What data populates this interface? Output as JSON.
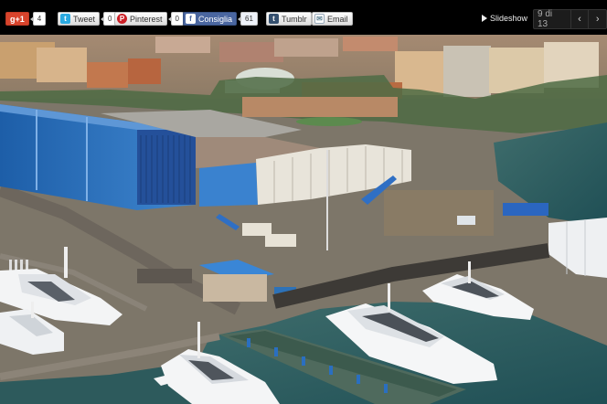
{
  "share": {
    "googleplus": {
      "label": "g+1",
      "count": "4"
    },
    "twitter": {
      "label": "Tweet",
      "count": "0"
    },
    "pinterest": {
      "label": "Pinterest",
      "count": "0"
    },
    "facebook": {
      "label": "Consiglia",
      "count": "61"
    },
    "tumblr": {
      "label": "Tumblr"
    },
    "email": {
      "label": "Email"
    }
  },
  "gallery": {
    "slideshow_label": "Slideshow",
    "counter": "9 di 13",
    "prev_icon": "chevron-left-icon",
    "next_icon": "chevron-right-icon"
  },
  "colors": {
    "bar_bg": "#000000",
    "facebook": "#4a66a0",
    "googleplus": "#d8442c",
    "twitter": "#2aa9e0",
    "pinterest": "#cb2027",
    "shed_blue": "#2f6fb8",
    "water": "#2f5f61"
  }
}
